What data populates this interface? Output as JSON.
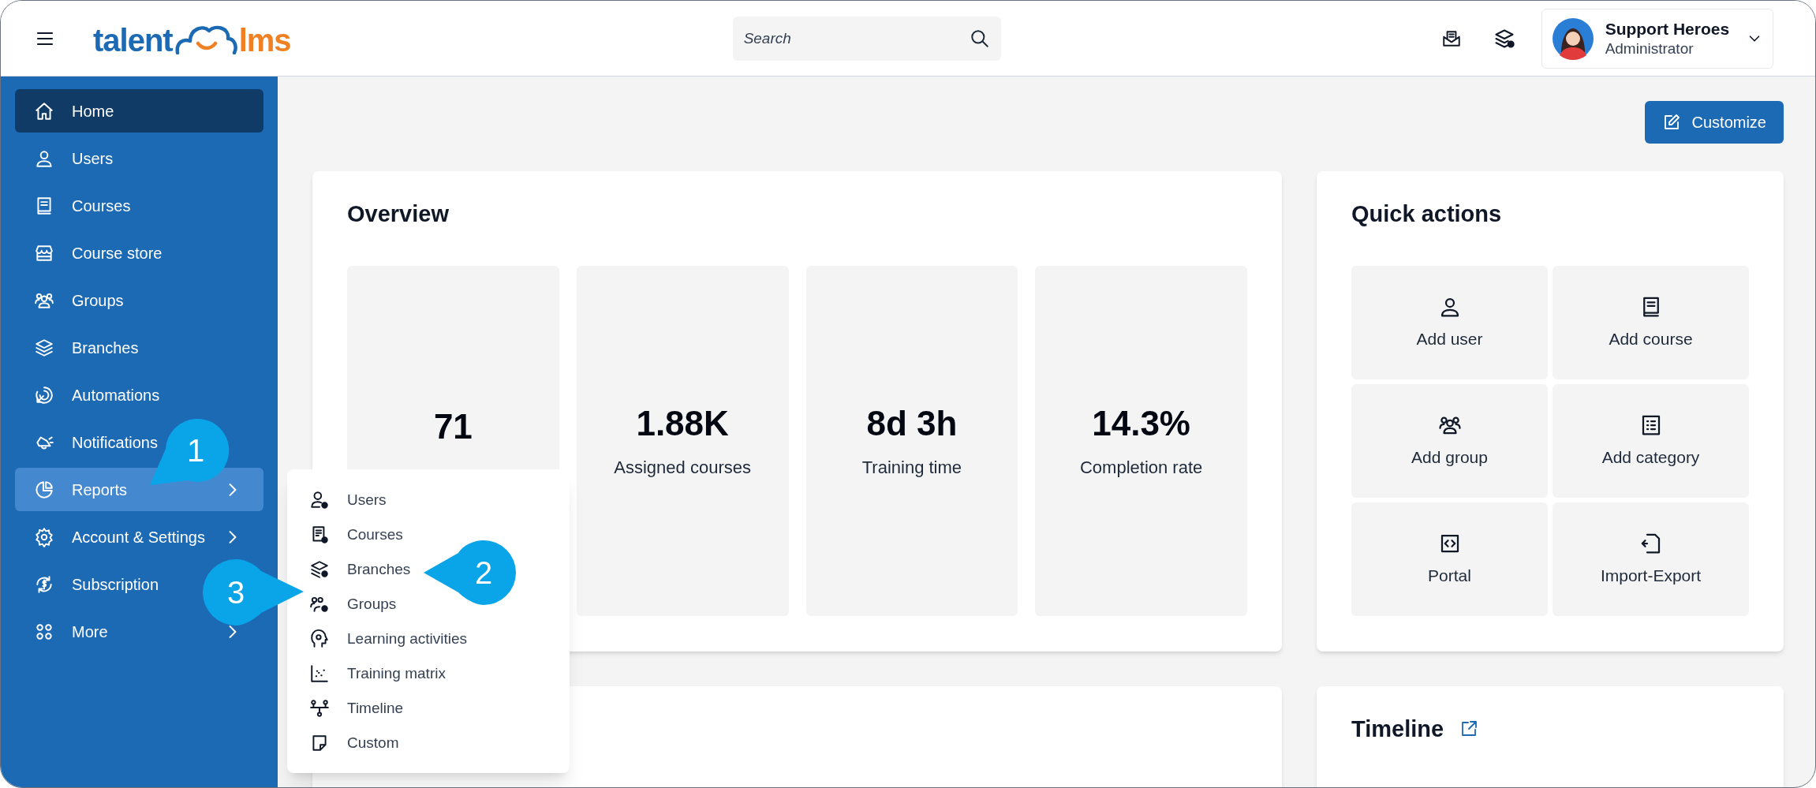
{
  "topbar": {
    "logo": {
      "left": "talent",
      "right": "lms"
    },
    "search": {
      "placeholder": "Search"
    },
    "user": {
      "name": "Support Heroes",
      "role": "Administrator"
    }
  },
  "sidebar": {
    "items": [
      {
        "label": "Home",
        "selected": true,
        "hovered": false,
        "submenu": false
      },
      {
        "label": "Users",
        "selected": false,
        "hovered": false,
        "submenu": false
      },
      {
        "label": "Courses",
        "selected": false,
        "hovered": false,
        "submenu": false
      },
      {
        "label": "Course store",
        "selected": false,
        "hovered": false,
        "submenu": false
      },
      {
        "label": "Groups",
        "selected": false,
        "hovered": false,
        "submenu": false
      },
      {
        "label": "Branches",
        "selected": false,
        "hovered": false,
        "submenu": false
      },
      {
        "label": "Automations",
        "selected": false,
        "hovered": false,
        "submenu": false
      },
      {
        "label": "Notifications",
        "selected": false,
        "hovered": false,
        "submenu": false
      },
      {
        "label": "Reports",
        "selected": false,
        "hovered": true,
        "submenu": true
      },
      {
        "label": "Account & Settings",
        "selected": false,
        "hovered": false,
        "submenu": true
      },
      {
        "label": "Subscription",
        "selected": false,
        "hovered": false,
        "submenu": false
      },
      {
        "label": "More",
        "selected": false,
        "hovered": false,
        "submenu": true
      }
    ]
  },
  "reports_menu": {
    "items": [
      "Users",
      "Courses",
      "Branches",
      "Groups",
      "Learning activities",
      "Training matrix",
      "Timeline",
      "Custom"
    ]
  },
  "callouts": [
    {
      "number": "1"
    },
    {
      "number": "2"
    },
    {
      "number": "3"
    }
  ],
  "customize_button": "Customize",
  "overview": {
    "title": "Overview",
    "stats": [
      {
        "value": "71"
      },
      {
        "value": "1.88K",
        "label": "Assigned courses"
      },
      {
        "value": "8d 3h",
        "label": "Training time"
      },
      {
        "value": "14.3%",
        "label": "Completion rate"
      }
    ]
  },
  "quick_actions": {
    "title": "Quick actions",
    "actions": [
      "Add user",
      "Add course",
      "Add group",
      "Add category",
      "Portal",
      "Import-Export"
    ]
  },
  "timeline": {
    "title": "Timeline"
  }
}
